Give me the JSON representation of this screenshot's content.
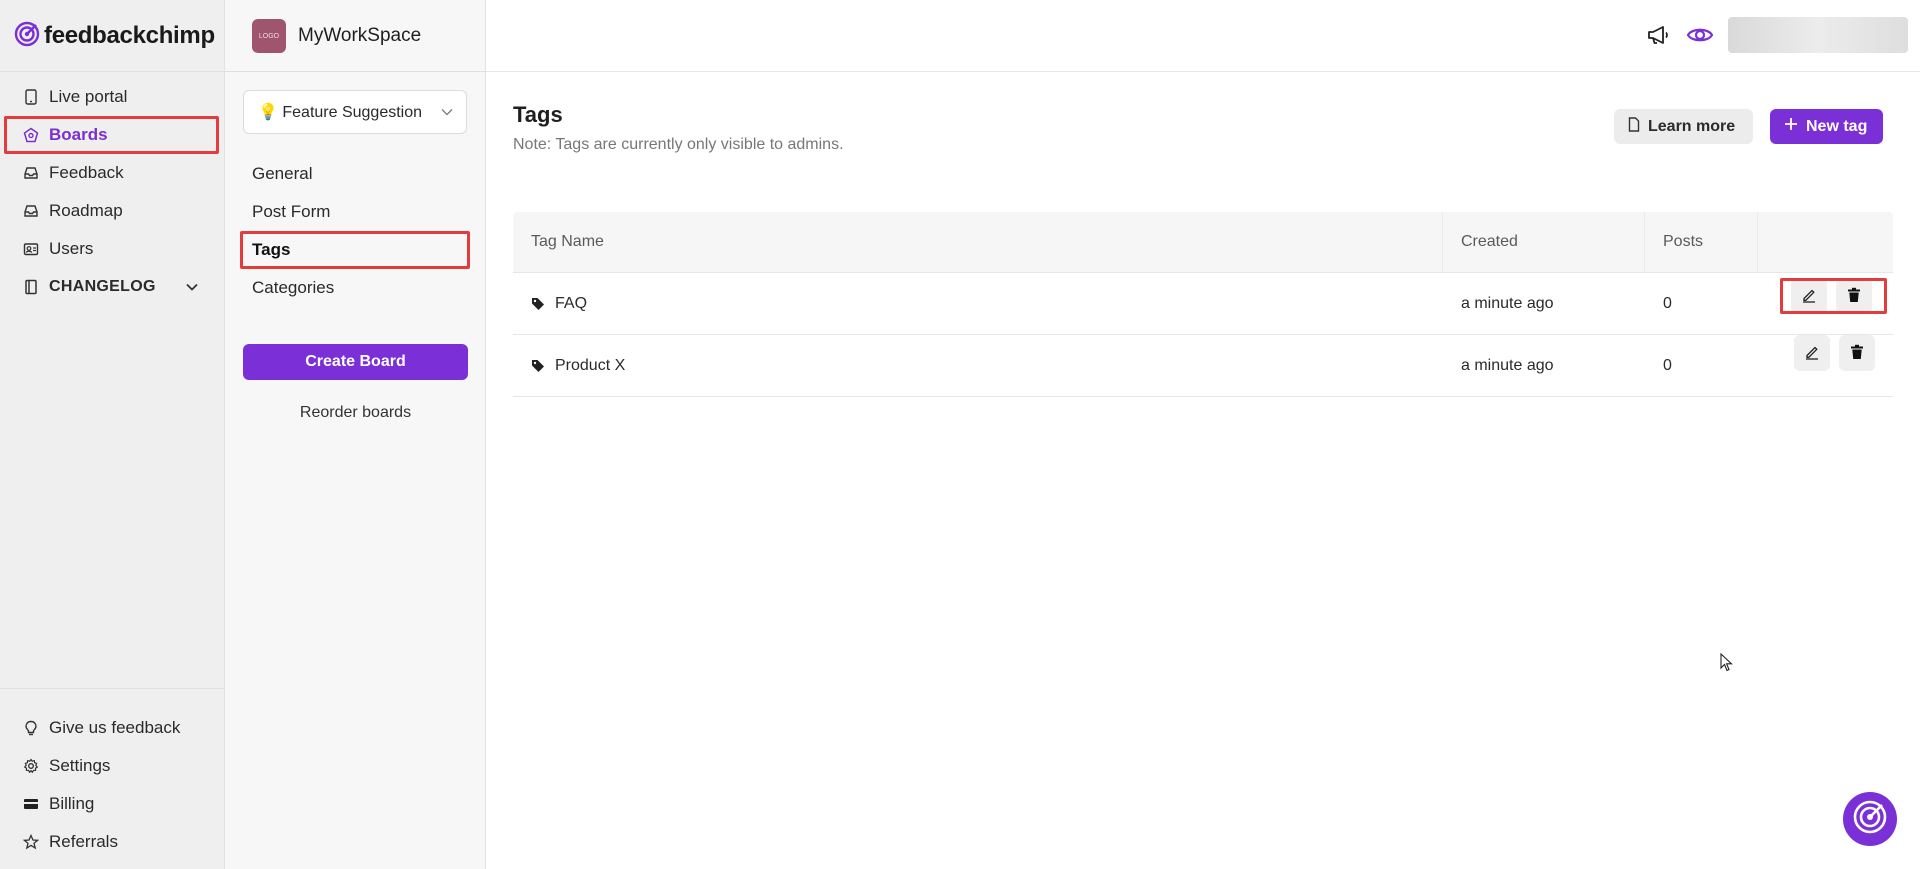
{
  "brand": {
    "name": "feedbackchimp",
    "accent": "#7b2fd6"
  },
  "sidebar": {
    "items": [
      {
        "label": "Live portal",
        "icon": "phone-icon"
      },
      {
        "label": "Boards",
        "icon": "boards-icon",
        "active": true
      },
      {
        "label": "Feedback",
        "icon": "inbox-icon"
      },
      {
        "label": "Roadmap",
        "icon": "inbox-icon"
      },
      {
        "label": "Users",
        "icon": "users-icon"
      },
      {
        "label": "CHANGELOG",
        "icon": "book-icon"
      }
    ],
    "bottom": [
      {
        "label": "Give us feedback",
        "icon": "lightbulb-icon"
      },
      {
        "label": "Settings",
        "icon": "gear-icon"
      },
      {
        "label": "Billing",
        "icon": "card-icon"
      },
      {
        "label": "Referrals",
        "icon": "star-icon"
      }
    ]
  },
  "workspace": {
    "name": "MyWorkSpace",
    "logo_text": "LOGO"
  },
  "board_select": {
    "value": "💡 Feature Suggestion"
  },
  "board_nav": {
    "items": [
      "General",
      "Post Form",
      "Tags",
      "Categories"
    ],
    "active": "Tags",
    "create_label": "Create Board",
    "reorder_label": "Reorder boards"
  },
  "page": {
    "title": "Tags",
    "note": "Note: Tags are currently only visible to admins.",
    "learn_more": "Learn more",
    "new_tag": "New tag"
  },
  "table": {
    "headers": [
      "Tag Name",
      "Created",
      "Posts",
      ""
    ],
    "rows": [
      {
        "name": "FAQ",
        "created": "a minute ago",
        "posts": "0"
      },
      {
        "name": "Product X",
        "created": "a minute ago",
        "posts": "0"
      }
    ]
  }
}
